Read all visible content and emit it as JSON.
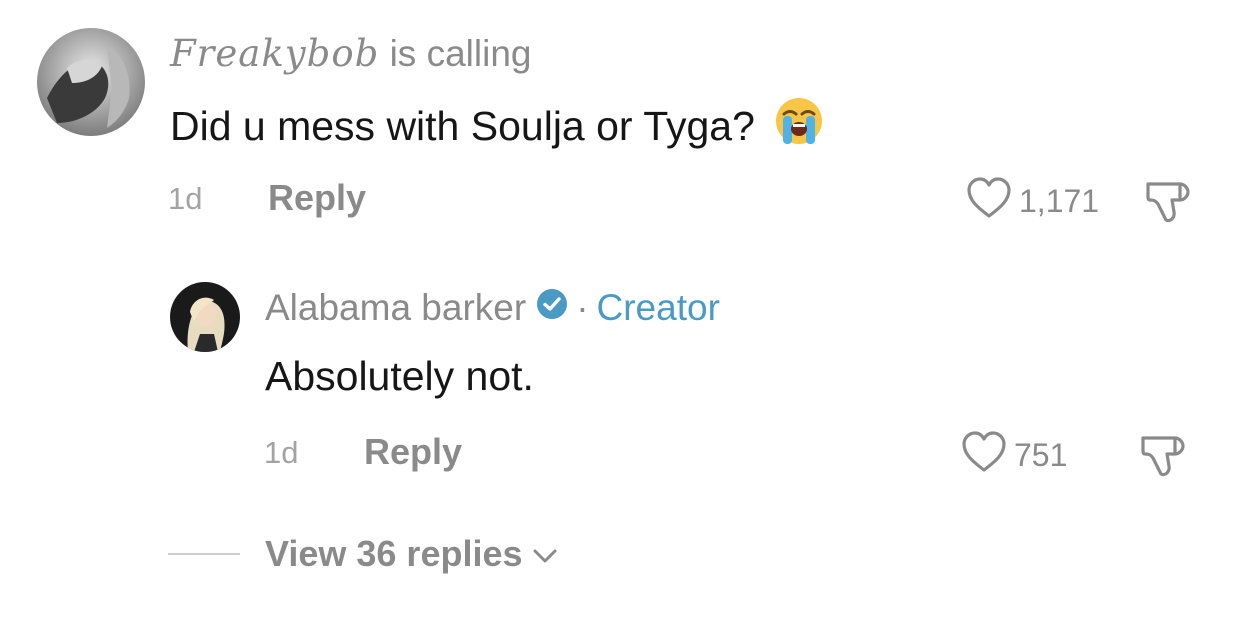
{
  "comment": {
    "username": "Freakybob",
    "username_suffix": "is calling",
    "text": "Did u mess with Soulja or Tyga?",
    "emoji": "loudly-crying-face",
    "time": "1d",
    "reply_label": "Reply",
    "like_count": "1,171"
  },
  "reply": {
    "username": "Alabama barker",
    "dot": "·",
    "role": "Creator",
    "text": "Absolutely not.",
    "time": "1d",
    "reply_label": "Reply",
    "like_count": "751"
  },
  "view_replies": {
    "label": "View 36 replies"
  },
  "colors": {
    "text_primary": "#161616",
    "text_secondary": "#8a8a8a",
    "verified": "#4a9ac4",
    "emoji_yellow": "#f7c646"
  }
}
